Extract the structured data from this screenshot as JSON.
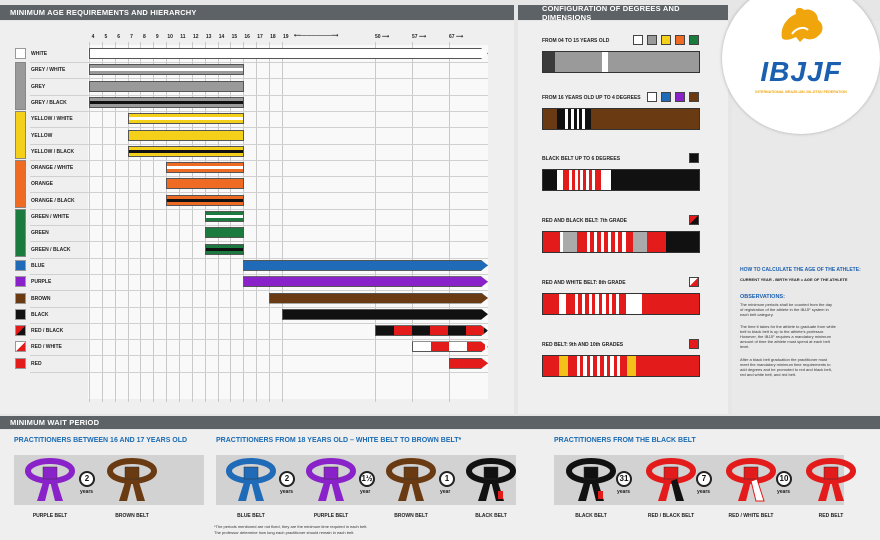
{
  "header": {
    "age_title": "MINIMUM AGE REQUIREMENTS AND HIERARCHY",
    "config_title": "CONFIGURATION OF DEGREES AND DIMENSIONS",
    "wait_title": "MINIMUM WAIT PERIOD"
  },
  "logo": {
    "name": "IBJJF",
    "subtitle": "INTERNATIONAL BRAZILIAN JIU-JITSU FEDERATION"
  },
  "ages": {
    "ticks": [
      "4",
      "5",
      "6",
      "7",
      "8",
      "9",
      "10",
      "11",
      "12",
      "13",
      "14",
      "15",
      "16",
      "17",
      "18",
      "19"
    ],
    "arrows": [
      "50",
      "57",
      "67"
    ]
  },
  "belts": [
    {
      "label": "WHITE",
      "color": "#ffffff",
      "start": "4",
      "stripe": "#ffffff",
      "arrow": true
    },
    {
      "label": "GREY / WHITE",
      "color": "#9a9a9a",
      "start": "4",
      "stripe": "#ffffff"
    },
    {
      "label": "GREY",
      "color": "#9a9a9a",
      "start": "4",
      "stripe": "#9a9a9a"
    },
    {
      "label": "GREY / BLACK",
      "color": "#9a9a9a",
      "start": "4",
      "stripe": "#111111"
    },
    {
      "label": "YELLOW / WHITE",
      "color": "#f4d01a",
      "start": "7",
      "stripe": "#ffffff"
    },
    {
      "label": "YELLOW",
      "color": "#f4d01a",
      "start": "7",
      "stripe": "#f4d01a"
    },
    {
      "label": "YELLOW / BLACK",
      "color": "#f4d01a",
      "start": "7",
      "stripe": "#111111"
    },
    {
      "label": "ORANGE / WHITE",
      "color": "#ef6a23",
      "start": "10",
      "stripe": "#ffffff"
    },
    {
      "label": "ORANGE",
      "color": "#ef6a23",
      "start": "10",
      "stripe": "#ef6a23"
    },
    {
      "label": "ORANGE / BLACK",
      "color": "#ef6a23",
      "start": "10",
      "stripe": "#111111"
    },
    {
      "label": "GREEN / WHITE",
      "color": "#1b7a3e",
      "start": "13",
      "stripe": "#ffffff"
    },
    {
      "label": "GREEN",
      "color": "#1b7a3e",
      "start": "13",
      "stripe": "#1b7a3e"
    },
    {
      "label": "GREEN / BLACK",
      "color": "#1b7a3e",
      "start": "13",
      "stripe": "#111111"
    },
    {
      "label": "BLUE",
      "color": "#1f6bb8",
      "start": "16",
      "stripe": "#1f6bb8",
      "arrow": true
    },
    {
      "label": "PURPLE",
      "color": "#8a22c9",
      "start": "16",
      "stripe": "#8a22c9",
      "arrow": true
    },
    {
      "label": "BROWN",
      "color": "#6a3a13",
      "start": "18",
      "stripe": "#6a3a13",
      "arrow": true
    },
    {
      "label": "BLACK",
      "color": "#111111",
      "start": "19",
      "stripe": "#111111",
      "arrow": true
    },
    {
      "label": "RED / BLACK",
      "color": "#e31b1b",
      "start": "50",
      "stripe": "#111111",
      "arrow": true,
      "pattern": "rb"
    },
    {
      "label": "RED / WHITE",
      "color": "#e31b1b",
      "start": "57",
      "stripe": "#ffffff",
      "arrow": true,
      "pattern": "rw"
    },
    {
      "label": "RED",
      "color": "#e31b1b",
      "start": "67",
      "stripe": "#e31b1b",
      "arrow": true
    }
  ],
  "config": {
    "items": [
      {
        "label": "FROM 04 TO 15 YEARS OLD",
        "squares": [
          "#ffffff",
          "#9a9a9a",
          "#f4d01a",
          "#ef6a23",
          "#1b7a3e"
        ]
      },
      {
        "label": "FROM 16 YEARS OLD UP TO 4 DEGREES",
        "squares": [
          "#ffffff",
          "#1f6bb8",
          "#8a22c9",
          "#6a3a13"
        ]
      },
      {
        "label": "BLACK BELT UP TO 6 DEGREES",
        "squares": [
          "#111111"
        ]
      },
      {
        "label": "RED AND BLACK BELT: 7th GRADE",
        "squares": [
          "rb"
        ]
      },
      {
        "label": "RED AND WHITE BELT: 8th GRADE",
        "squares": [
          "rw"
        ]
      },
      {
        "label": "RED BELT: 9th AND 10th GRADES",
        "squares": [
          "#e31b1b"
        ]
      }
    ]
  },
  "info": {
    "calc_title": "HOW TO CALCULATE THE AGE OF THE ATHLETE:",
    "calc_formula": "CURRENT YEAR - BIRTH YEAR = AGE OF THE ATHLETE",
    "obs_title": "OBSERVATIONS:",
    "obs1": "The minimum periods shall be counted from the day of registration of the athlete in the IBJJF system in each belt category.",
    "obs2": "The time it takes for the athlete to graduate from white belt to black belt is up to the athlete's professor. However, the IBJJF requires a mandatory minimum amount of time the athlete must spend at each belt level.",
    "obs3": "After a black belt graduation the practitioner must meet the mandatory minimum time requirements to add degrees and be promoted to red and black belt, red and white belt, and red belt."
  },
  "wait": {
    "sec1": "PRACTITIONERS BETWEEN 16 AND 17 YEARS OLD",
    "sec2": "PRACTITIONERS FROM 18 YEARS OLD – WHITE BELT TO BROWN BELT*",
    "sec3": "PRACTITIONERS FROM THE BLACK BELT",
    "footnote1": "*The periods mentioned are not fixed, they are the minimum time required in each belt.",
    "footnote2": "The professor determine how long each practitioner should remain in each belt.",
    "belts": [
      {
        "label": "PURPLE BELT",
        "color": "#8a22c9"
      },
      {
        "label": "BROWN BELT",
        "color": "#6a3a13"
      },
      {
        "label": "BLUE BELT",
        "color": "#1f6bb8"
      },
      {
        "label": "PURPLE BELT",
        "color": "#8a22c9"
      },
      {
        "label": "BROWN BELT",
        "color": "#6a3a13"
      },
      {
        "label": "BLACK BELT",
        "color": "#111111"
      },
      {
        "label": "BLACK BELT",
        "color": "#111111"
      },
      {
        "label": "RED / BLACK BELT",
        "color": "#e31b1b"
      },
      {
        "label": "RED / WHITE BELT",
        "color": "#e31b1b"
      },
      {
        "label": "RED BELT",
        "color": "#e31b1b"
      }
    ],
    "periods": [
      {
        "num": "2",
        "unit": "years"
      },
      {
        "num": "2",
        "unit": "years"
      },
      {
        "num": "1½",
        "unit": "year"
      },
      {
        "num": "1",
        "unit": "year"
      },
      {
        "num": "31",
        "unit": "years"
      },
      {
        "num": "7",
        "unit": "years"
      },
      {
        "num": "10",
        "unit": "years"
      }
    ]
  }
}
